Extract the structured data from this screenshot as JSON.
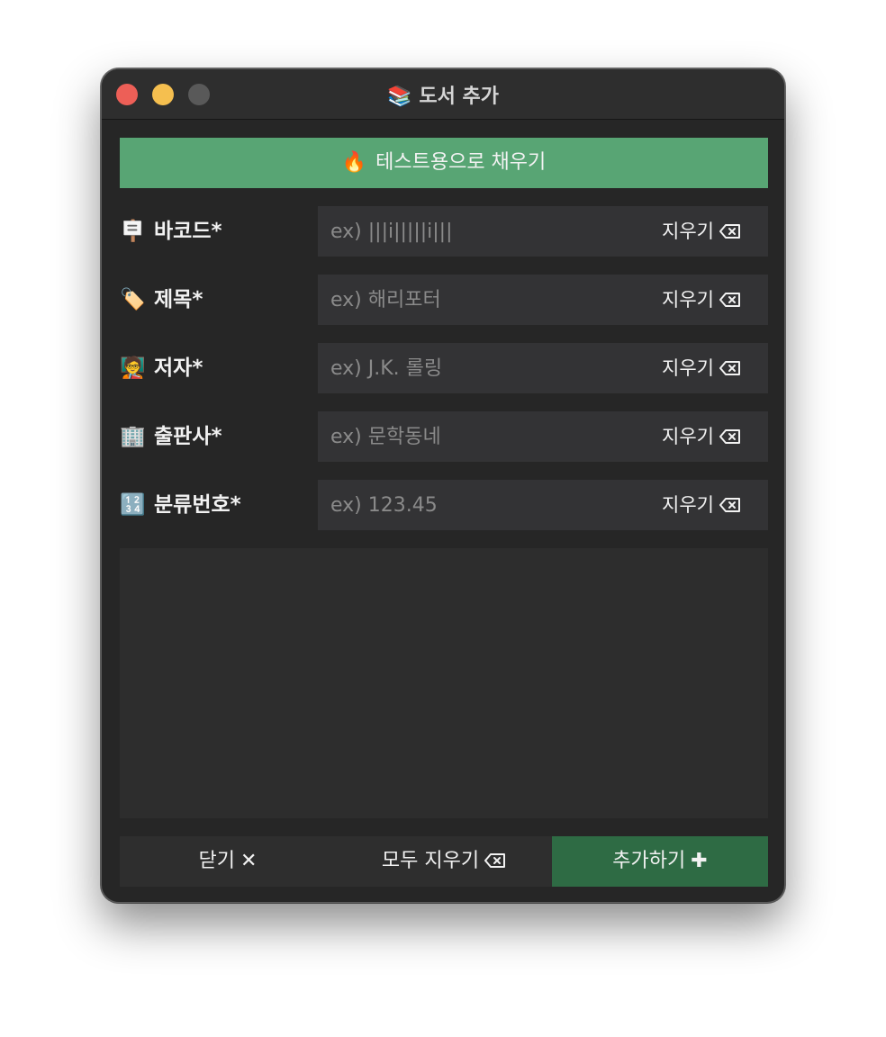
{
  "window": {
    "title": "도서 추가",
    "title_icon": "📚"
  },
  "test_fill": {
    "icon": "🔥",
    "label": "테스트용으로 채우기"
  },
  "fields": [
    {
      "icon": "🪧",
      "label": "바코드*",
      "placeholder": "ex) |||i|||||i|||",
      "clear_label": "지우기"
    },
    {
      "icon": "🏷️",
      "label": "제목*",
      "placeholder": "ex) 해리포터",
      "clear_label": "지우기"
    },
    {
      "icon": "🧑‍🏫",
      "label": "저자*",
      "placeholder": "ex) J.K. 롤링",
      "clear_label": "지우기"
    },
    {
      "icon": "🏢",
      "label": "출판사*",
      "placeholder": "ex) 문학동네",
      "clear_label": "지우기"
    },
    {
      "icon": "🔢",
      "label": "분류번호*",
      "placeholder": "ex) 123.45",
      "clear_label": "지우기"
    }
  ],
  "bottom": {
    "close_label": "닫기",
    "close_glyph": "✕",
    "clear_all_label": "모두 지우기",
    "add_label": "추가하기",
    "add_glyph": "✚"
  },
  "colors": {
    "window_bg": "#262626",
    "test_fill_bg": "#58a574",
    "add_button_bg": "#2e6b44",
    "field_bg": "#333335"
  }
}
